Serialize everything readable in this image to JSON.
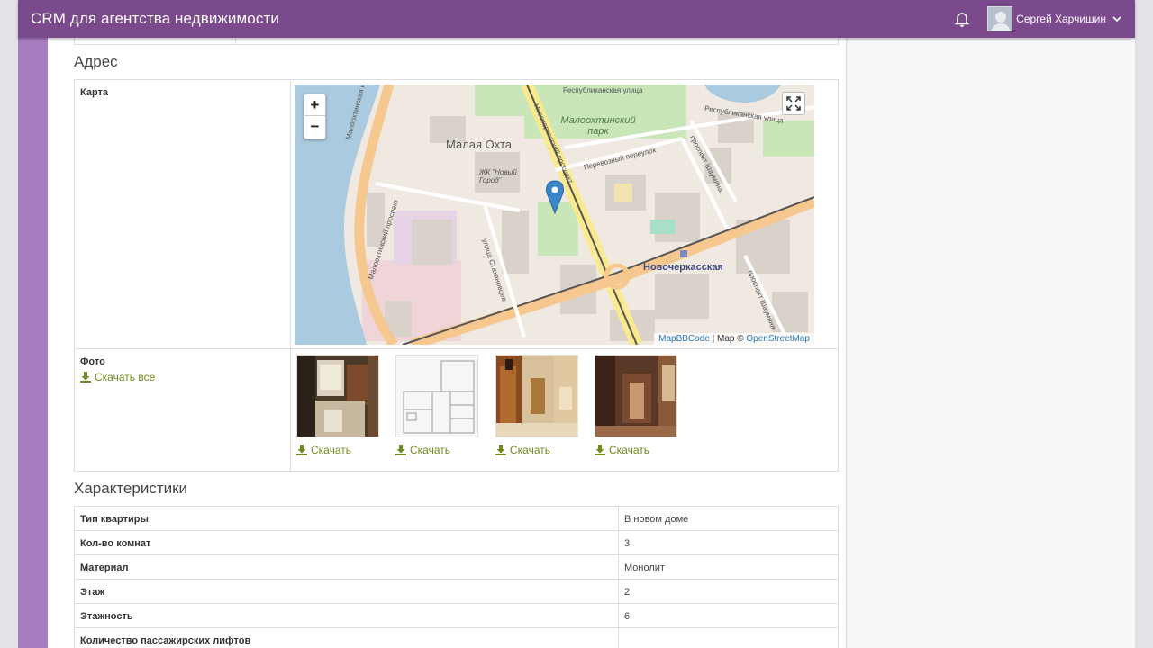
{
  "header": {
    "app_title": "CRM для агентства недвижимости",
    "user_name": "Сергей Харчишин"
  },
  "address_section": {
    "title": "Адрес",
    "map_label": "Карта",
    "photo_label": "Фото",
    "download_all": "Скачать все",
    "map": {
      "zoom_in": "+",
      "zoom_out": "−",
      "attribution_mapbb": "MapBBCode",
      "attribution_sep": " | Map © ",
      "attribution_osm": "OpenStreetMap",
      "labels": {
        "district": "Малая Охта",
        "park": "Малоохтинский парк",
        "complex": "ЖК \"Новый Город\"",
        "metro": "Новочеркасская",
        "quay": "Малоохтинская набережная",
        "prospect_mo": "Малоохтинский проспект",
        "prospect_nov": "Новочеркасский проспект",
        "street_resp": "Республиканская улица",
        "street_resp2": "Республиканская улица",
        "pereulok": "Перевозный переулок",
        "street_stakh": "улица Стахановцев",
        "prospect_shum": "проспект Шаумяна",
        "prospect_shum2": "проспект Шаумяна"
      }
    },
    "photos": [
      {
        "download_label": "Скачать",
        "kind": "kitchen"
      },
      {
        "download_label": "Скачать",
        "kind": "floor-plan"
      },
      {
        "download_label": "Скачать",
        "kind": "hallway"
      },
      {
        "download_label": "Скачать",
        "kind": "corridor"
      }
    ]
  },
  "characteristics": {
    "title": "Характеристики",
    "rows": [
      {
        "key": "Тип квартиры",
        "value": "В новом доме"
      },
      {
        "key": "Кол-во комнат",
        "value": "3"
      },
      {
        "key": "Материал",
        "value": "Монолит"
      },
      {
        "key": "Этаж",
        "value": "2"
      },
      {
        "key": "Этажность",
        "value": "6"
      },
      {
        "key": "Количество пассажирских лифтов",
        "value": ""
      }
    ]
  },
  "colors": {
    "topbar": "#7a4a8d",
    "sidebar": "#a87cc0",
    "download_link": "#6f8a1e",
    "map_marker": "#3a86c8"
  }
}
